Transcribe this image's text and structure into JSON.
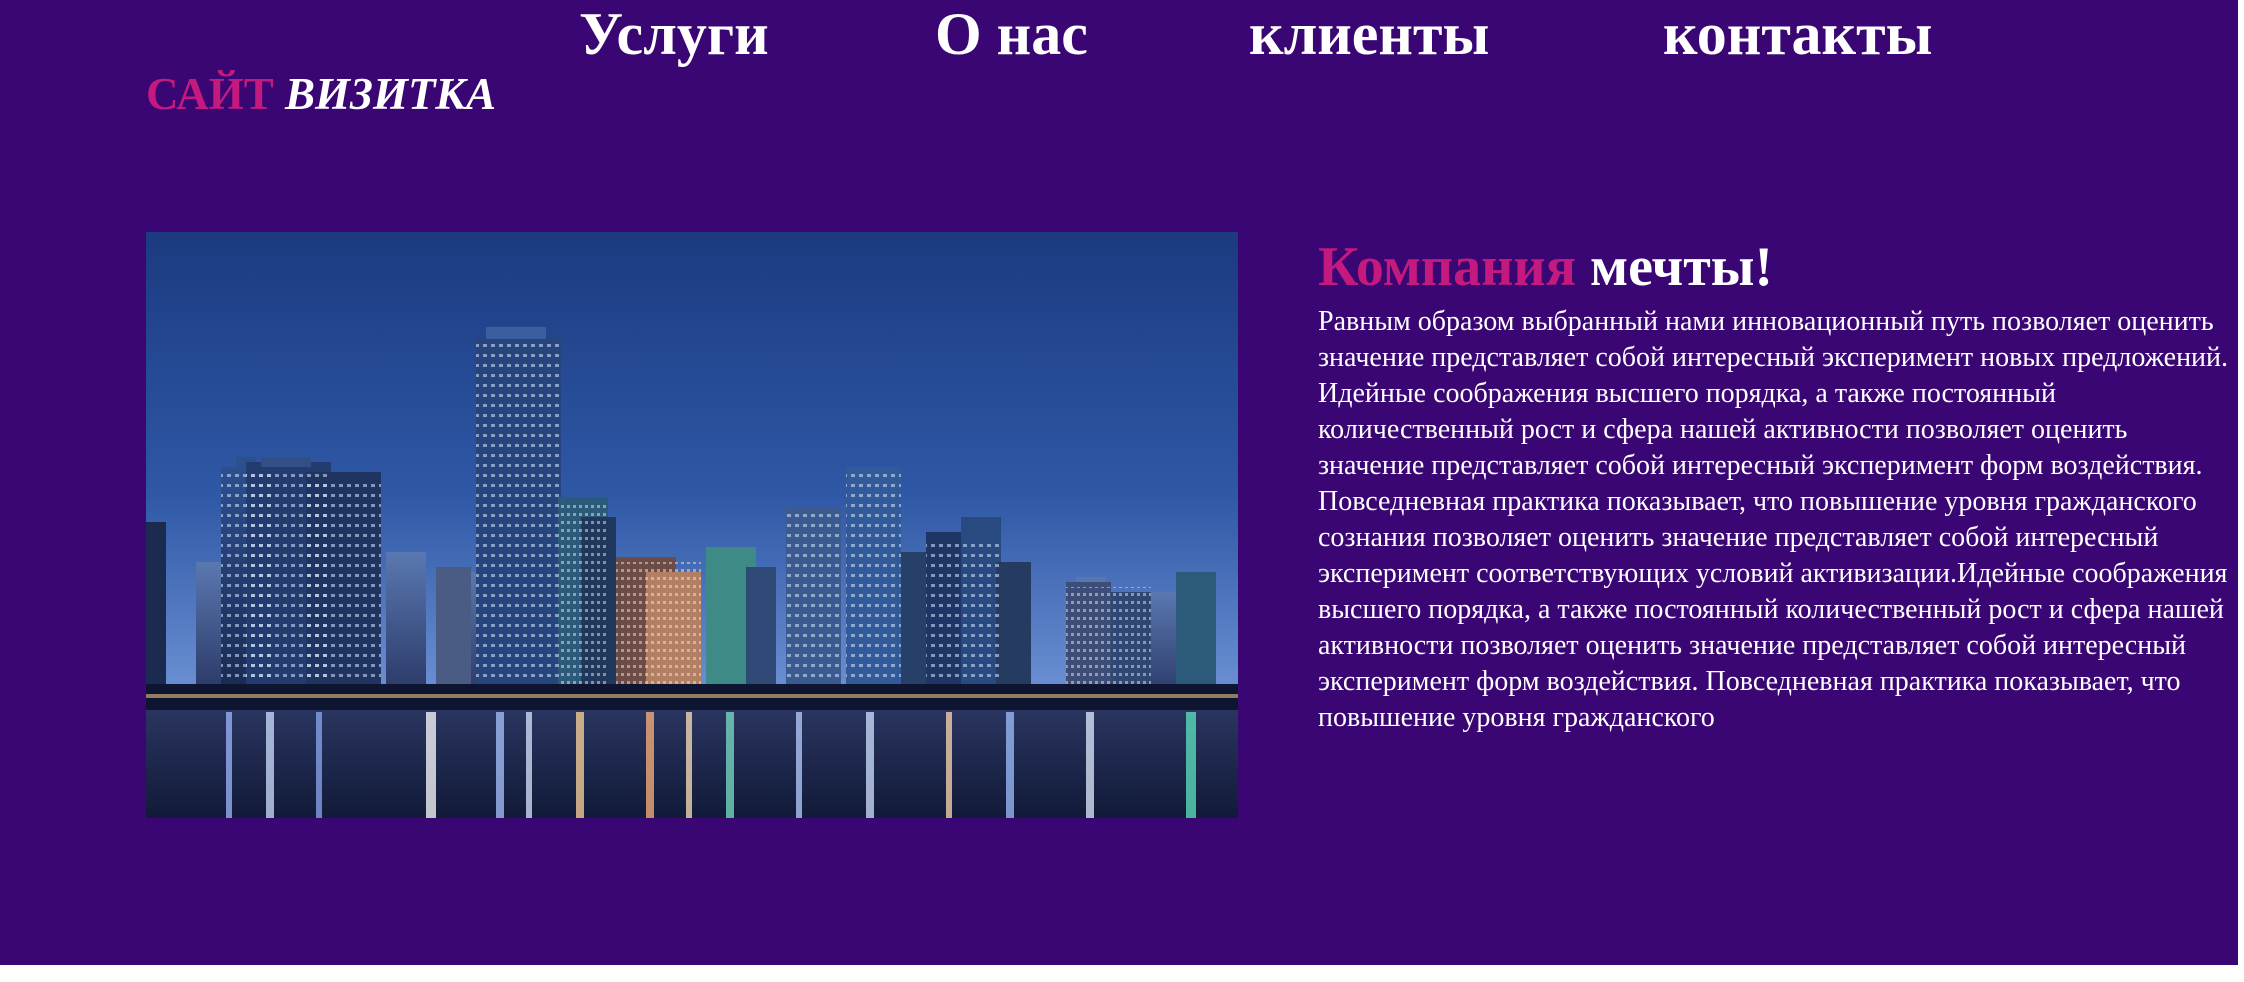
{
  "nav": {
    "items": [
      {
        "label": "Услуги"
      },
      {
        "label": "О нас"
      },
      {
        "label": "клиенты"
      },
      {
        "label": "контакты"
      }
    ]
  },
  "logo": {
    "part1": "САЙТ",
    "part2": "ВИЗИТКА"
  },
  "article": {
    "title_part1": "Компания",
    "title_part2": "мечты!",
    "body": "Равным образом выбранный нами инновационный путь позволяет оценить значение представляет собой интересный эксперимент новых предложений. Идейные соображения высшего порядка, а также постоянный количественный рост и сфера нашей активности позволяет оценить значение представляет собой интересный эксперимент форм воздействия. Повседневная практика показывает, что повышение уровня гражданского сознания позволяет оценить значение представляет собой интересный эксперимент соответствующих условий активизации.Идейные соображения высшего порядка, а также постоянный количественный рост и сфера нашей активности позволяет оценить значение представляет собой интересный эксперимент форм воздействия. Повседневная практика показывает, что повышение уровня гражданского"
  },
  "colors": {
    "background": "#3a0673",
    "accent": "#c4197e",
    "text": "#ffffff"
  },
  "hero_image": {
    "icon": "city-skyline-night-image"
  }
}
